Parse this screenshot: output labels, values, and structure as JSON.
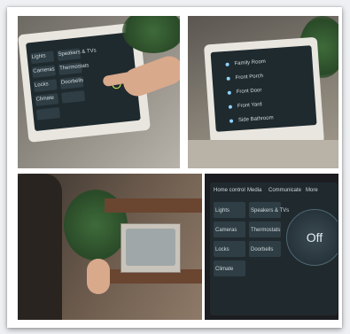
{
  "photo_top_left": {
    "menu": [
      {
        "label": "Lights"
      },
      {
        "label": "Speakers & TVs"
      },
      {
        "label": "Cameras"
      },
      {
        "label": "Thermostats"
      },
      {
        "label": "Locks"
      },
      {
        "label": "Doorbells"
      },
      {
        "label": "Climate"
      }
    ]
  },
  "photo_top_right": {
    "rows": [
      {
        "label": "Family Room"
      },
      {
        "label": "Front Porch"
      },
      {
        "label": "Front Door"
      },
      {
        "label": "Front Yard"
      },
      {
        "label": "Side Bathroom"
      }
    ]
  },
  "photo_bottom_right": {
    "tabs": [
      {
        "label": "Home control"
      },
      {
        "label": "Media"
      },
      {
        "label": "Communicate"
      },
      {
        "label": "More"
      }
    ],
    "tiles": [
      {
        "label": "Lights"
      },
      {
        "label": "Speakers & TVs"
      },
      {
        "label": "Cameras"
      },
      {
        "label": "Thermostats"
      },
      {
        "label": "Locks"
      },
      {
        "label": "Doorbells"
      },
      {
        "label": "Climate"
      }
    ],
    "power_state": "Off"
  }
}
